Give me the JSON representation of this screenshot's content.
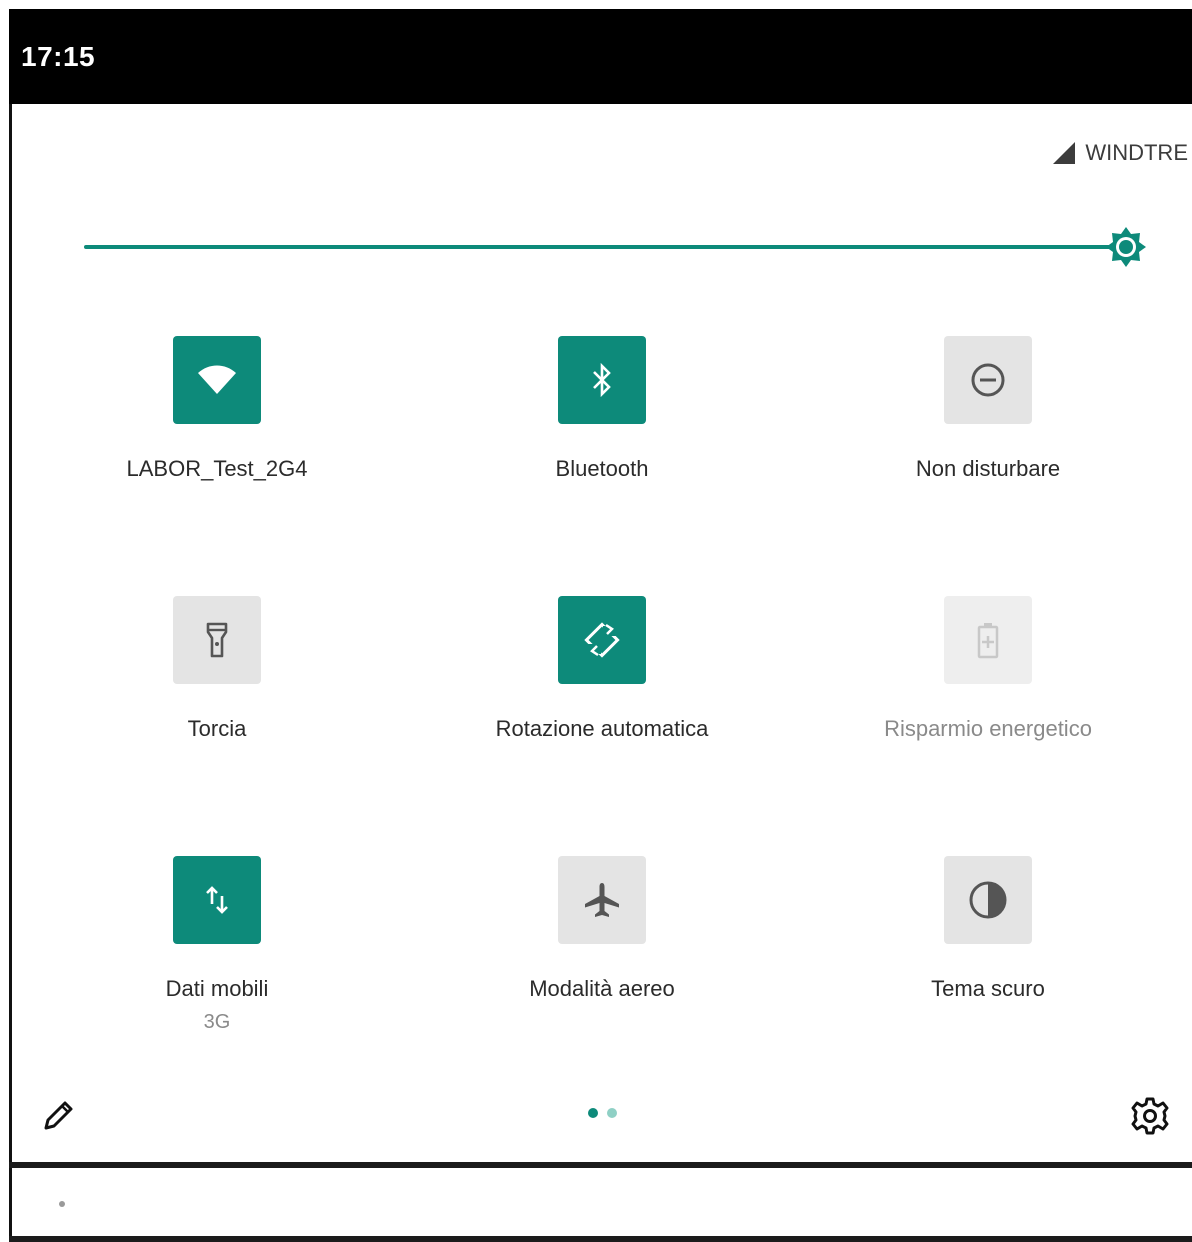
{
  "status_bar": {
    "time": "17:15"
  },
  "header": {
    "carrier": "WINDTRE",
    "signal_icon": "cellular-signal-icon"
  },
  "brightness": {
    "level": 1.0,
    "icon": "brightness-icon"
  },
  "tiles": [
    {
      "label": "LABOR_Test_2G4",
      "sub": "",
      "icon": "wifi-icon",
      "state": "on"
    },
    {
      "label": "Bluetooth",
      "sub": "",
      "icon": "bluetooth-icon",
      "state": "on"
    },
    {
      "label": "Non disturbare",
      "sub": "",
      "icon": "do-not-disturb-icon",
      "state": "off"
    },
    {
      "label": "Torcia",
      "sub": "",
      "icon": "flashlight-icon",
      "state": "off"
    },
    {
      "label": "Rotazione automatica",
      "sub": "",
      "icon": "auto-rotate-icon",
      "state": "on"
    },
    {
      "label": "Risparmio energetico",
      "sub": "",
      "icon": "battery-saver-icon",
      "state": "unavailable"
    },
    {
      "label": "Dati mobili",
      "sub": "3G",
      "icon": "mobile-data-icon",
      "state": "on"
    },
    {
      "label": "Modalità aereo",
      "sub": "",
      "icon": "airplane-icon",
      "state": "off"
    },
    {
      "label": "Tema scuro",
      "sub": "",
      "icon": "dark-theme-icon",
      "state": "off"
    }
  ],
  "footer": {
    "edit_icon": "edit-pencil-icon",
    "settings_icon": "settings-gear-icon",
    "pages": {
      "count": 2,
      "current": 1
    }
  },
  "colors": {
    "accent": "#0d8a7a",
    "tile_off": "#e4e4e4",
    "dot_inactive": "#8fd0c5",
    "status_bar": "#000000"
  }
}
